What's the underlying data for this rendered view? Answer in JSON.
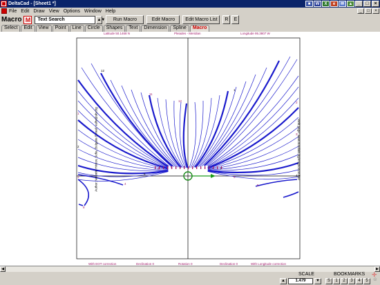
{
  "window": {
    "title": "DeltaCad - [Sheet1 *]"
  },
  "menu": {
    "items": [
      "File",
      "Edit",
      "Draw",
      "View",
      "Options",
      "Window",
      "Help"
    ]
  },
  "toolbar": {
    "label": "Macro",
    "m_button": "M",
    "search_value": "Text Search",
    "run_macro": "Run Macro",
    "edit_macro": "Edit Macro",
    "edit_macro_list": "Edit Macro List",
    "r_button": "R",
    "e_button": "E"
  },
  "tabs": [
    "Select",
    "Edit",
    "View",
    "Point",
    "Line",
    "Circle",
    "Shapes",
    "Text",
    "Dimension",
    "Spline",
    "Macro"
  ],
  "drawing": {
    "top_left": "Latitude 50.1468 N",
    "top_center": "Pleiades - Meridian",
    "top_right": "Longitude 95.3807 W",
    "left_side": "Author: Valentin Hristov, Sofia, Bulgaria    E-mail: valhr@abv.bg",
    "right_side": "Web page: www.sundials.bg/en/gnomon/flat/",
    "bottom": [
      "With EOT correction",
      "Declination 0",
      "Rotation 0",
      "Declination 0",
      "With Longitude correction"
    ],
    "line_labels": [
      "12",
      "11",
      "12",
      "1",
      "1",
      "2",
      "2",
      "3",
      "3",
      "4",
      "4",
      "5",
      "5",
      "6",
      "6",
      "7",
      "7",
      "8"
    ],
    "line_color": "#1a1acc",
    "label_color": "#a01868"
  },
  "status": {
    "scale_label": "SCALE",
    "scale_value": "1.479",
    "bookmarks_label": "BOOKMARKS",
    "bookmarks": [
      "S",
      "1",
      "2",
      "3",
      "4",
      "5"
    ]
  }
}
